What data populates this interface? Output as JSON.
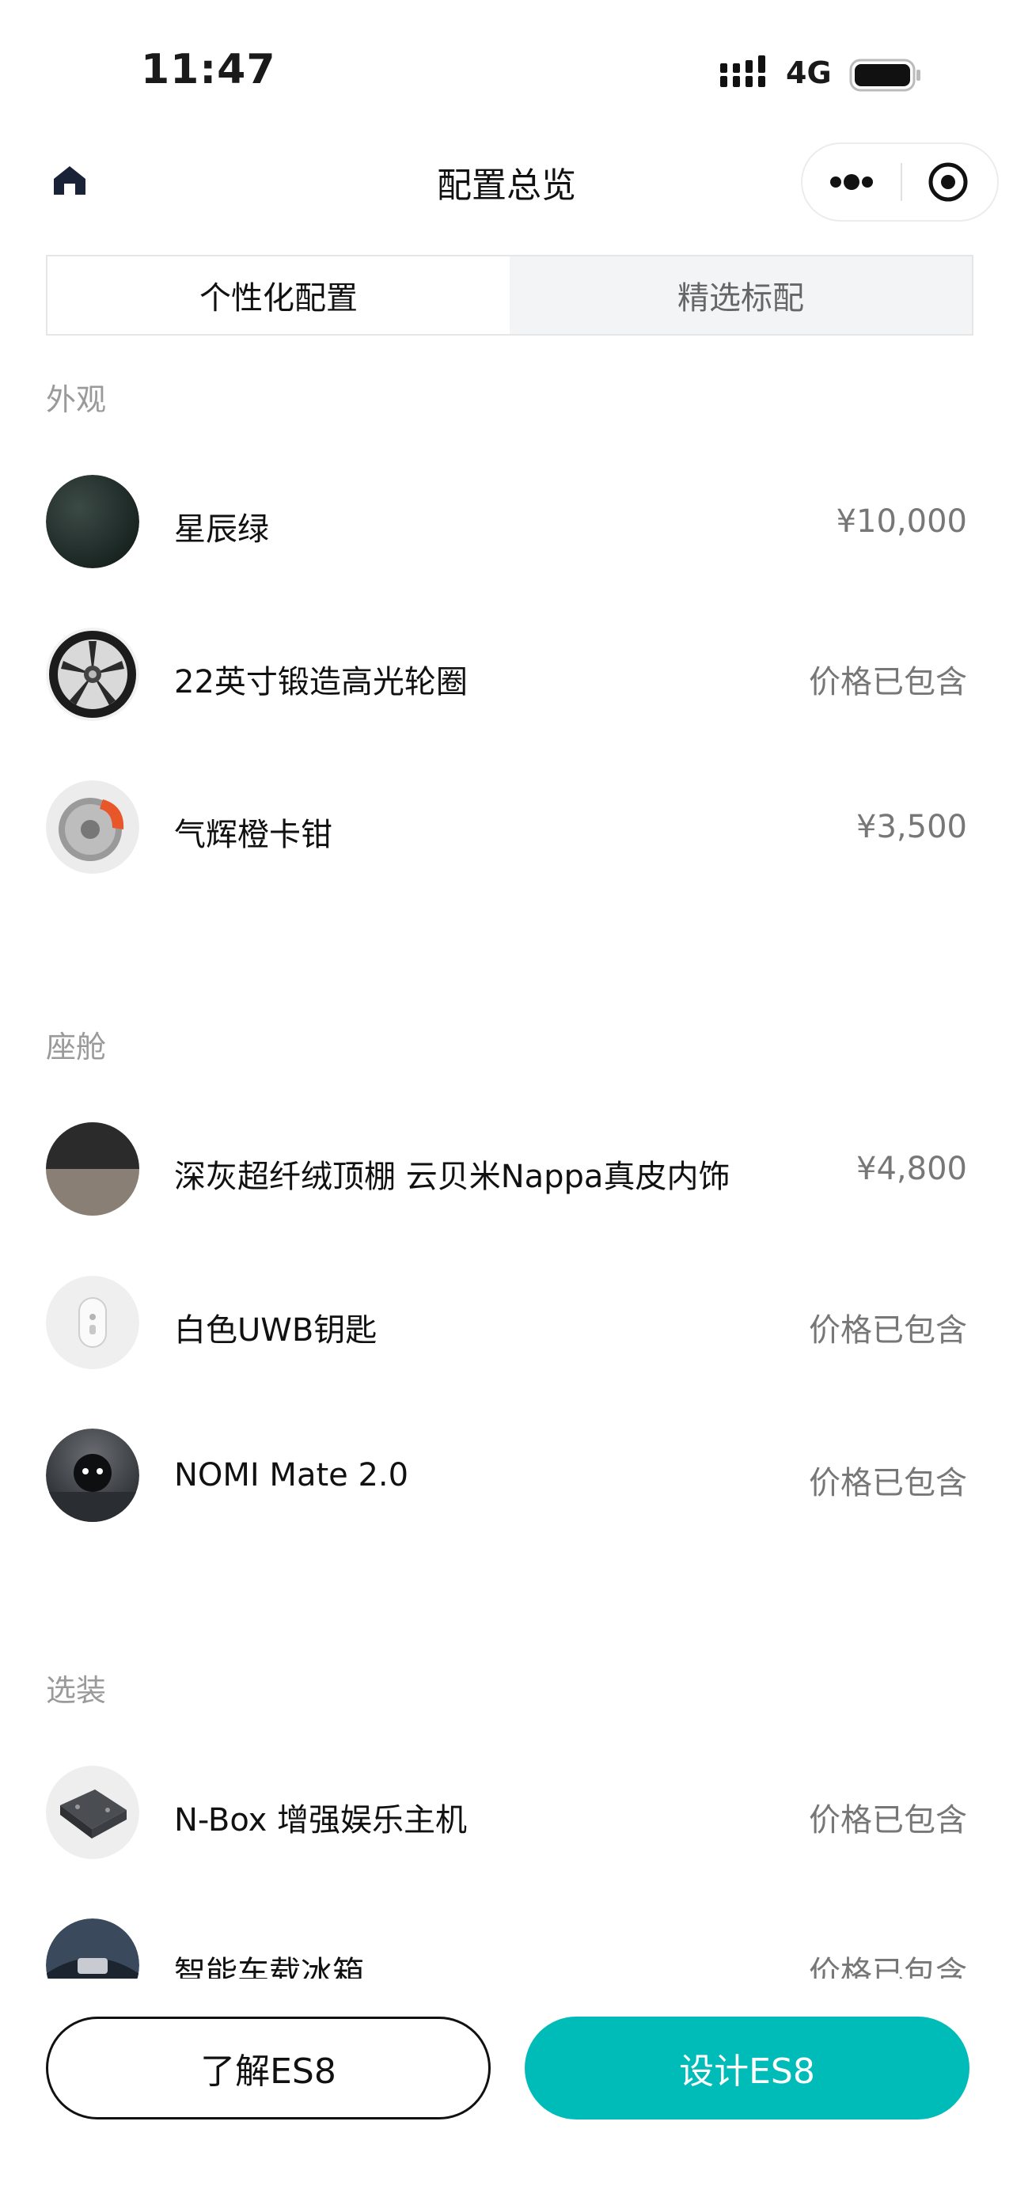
{
  "status_bar": {
    "time": "11:47",
    "network": "4G"
  },
  "nav": {
    "title": "配置总览"
  },
  "tabs": [
    {
      "label": "个性化配置",
      "active": true
    },
    {
      "label": "精选标配",
      "active": false
    }
  ],
  "sections": [
    {
      "title": "外观",
      "items": [
        {
          "name": "星辰绿",
          "price": "¥10,000",
          "icon": "green-paint-swatch"
        },
        {
          "name": "22英寸锻造高光轮圈",
          "price": "价格已包含",
          "icon": "wheel-image"
        },
        {
          "name": "气辉橙卡钳",
          "price": "¥3,500",
          "icon": "orange-caliper-image"
        }
      ]
    },
    {
      "title": "座舱",
      "items": [
        {
          "name": "深灰超纤绒顶棚 云贝米Nappa真皮内饰",
          "price": "¥4,800",
          "icon": "interior-swatch"
        },
        {
          "name": "白色UWB钥匙",
          "price": "价格已包含",
          "icon": "uwb-key-image"
        },
        {
          "name": "NOMI Mate 2.0",
          "price": "价格已包含",
          "icon": "nomi-image"
        }
      ]
    },
    {
      "title": "选装",
      "items": [
        {
          "name": "N-Box 增强娱乐主机",
          "price": "价格已包含",
          "icon": "nbox-image"
        },
        {
          "name": "智能车载冰箱",
          "price": "价格已包含",
          "icon": "fridge-image"
        }
      ]
    }
  ],
  "buttons": {
    "learn": "了解ES8",
    "design": "设计ES8"
  },
  "colors": {
    "accent": "#00bcb9",
    "text_primary": "#111111",
    "text_secondary": "#777777",
    "section_label": "#9a9a9a"
  }
}
